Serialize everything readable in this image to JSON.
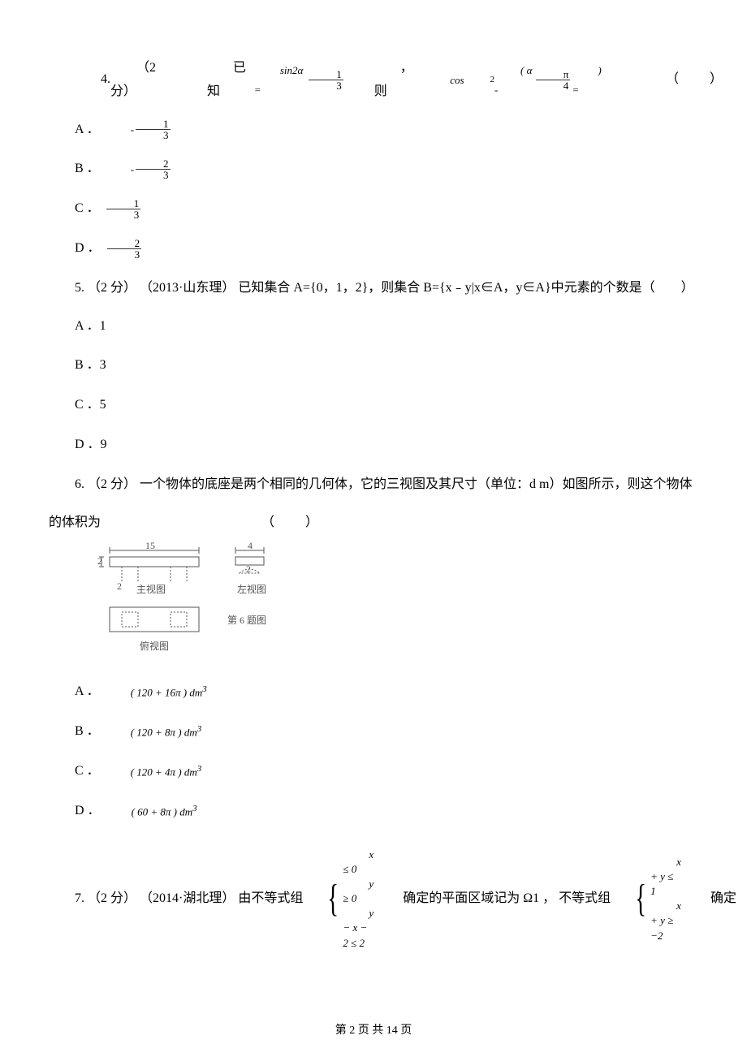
{
  "q4": {
    "number": "4.",
    "points": "（2 分）",
    "t1": "已知",
    "formula1_left": "sin2α =",
    "t2": "， 则",
    "formula2_left": "cos",
    "formula2_sup": "2",
    "formula2_paren": "( α -",
    "formula2_close": " ) =",
    "blank": "（　　）",
    "opts": {
      "A": "A ．",
      "B": "B ．",
      "C": "C ．",
      "D": "D ．"
    },
    "frac13": {
      "num": "1",
      "den": "3"
    },
    "frac23": {
      "num": "2",
      "den": "3"
    },
    "fracpi4": {
      "num": "π",
      "den": "4"
    }
  },
  "q5": {
    "number": "5.",
    "points": "（2 分）",
    "source": "（2013·山东理）",
    "text": "已知集合 A={0，1，2}，则集合 B={x﹣y|x∈A，y∈A}中元素的个数是（　　）",
    "opts": {
      "A": "A ．1",
      "B": "B ．3",
      "C": "C ．5",
      "D": "D ．9"
    }
  },
  "q6": {
    "number": "6.",
    "points": "（2 分）",
    "text1": "一个物体的底座是两个相同的几何体，它的三视图及其尺寸（单位：d m）如图所示，则这个物体",
    "text2": "的体积为",
    "blank": "（　　）",
    "fig": {
      "dim15": "15",
      "dim2a": "2",
      "dim2b": "2",
      "dim4": "4",
      "main_label": "主视图",
      "side_label": "左视图",
      "top_label": "俯视图",
      "caption": "第 6 题图"
    },
    "opts": {
      "A_pre": "A ．",
      "A_math": "( 120 + 16π ) dm",
      "B_pre": "B ．",
      "B_math": "( 120 + 8π ) dm",
      "C_pre": "C ．",
      "C_math": "( 120 + 4π ) dm",
      "D_pre": "D ．",
      "D_math": "( 60 + 8π ) dm",
      "sup3": "3"
    }
  },
  "q7": {
    "number": "7.",
    "points": "（2 分）",
    "source": "（2014·湖北理）",
    "t1": "由不等式组",
    "sys1": {
      "l1": "x ≤ 0",
      "l2": "y ≥ 0",
      "l3": "y − x − 2 ≤ 2"
    },
    "t2": "确定的平面区域记为 Ω1 ，  不等式组",
    "sys2": {
      "l1": "x + y ≤ 1",
      "l2": "x + y ≥ −2"
    },
    "t3": "确定"
  },
  "footer": "第 2 页 共 14 页"
}
